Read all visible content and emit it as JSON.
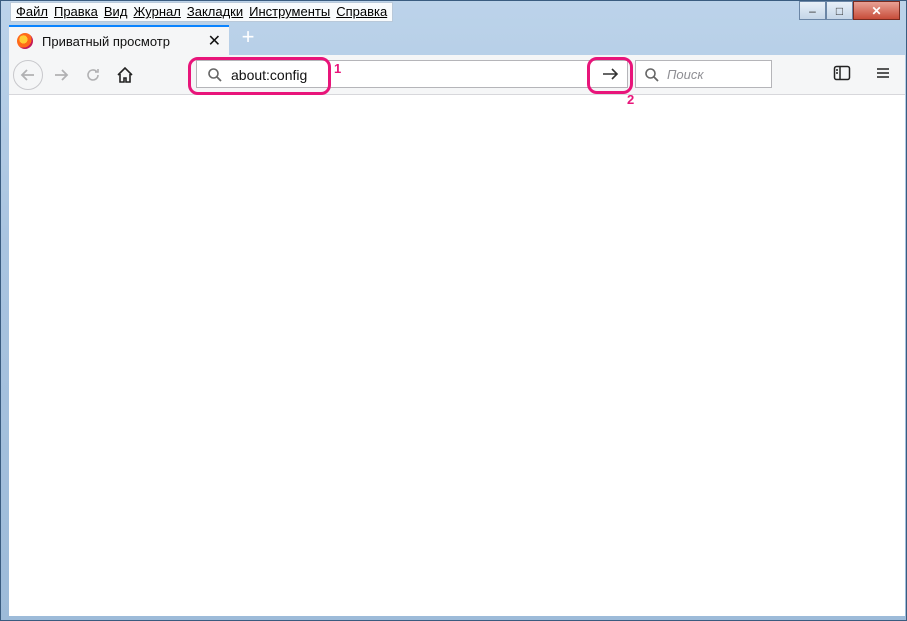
{
  "menu": [
    "Файл",
    "Правка",
    "Вид",
    "Журнал",
    "Закладки",
    "Инструменты",
    "Справка"
  ],
  "window_controls": {
    "minimize": "–",
    "maximize": "□",
    "close": "✕"
  },
  "tab": {
    "title": "Приватный просмотр",
    "close": "✕"
  },
  "new_tab": "+",
  "url": {
    "value": "about:config"
  },
  "search": {
    "placeholder": "Поиск"
  },
  "annotations": {
    "one": "1",
    "two": "2"
  },
  "colors": {
    "highlight": "#e8157a",
    "accent": "#0a84ff"
  },
  "icons": [
    "back-icon",
    "forward-icon",
    "reload-icon",
    "home-icon",
    "search-icon",
    "go-arrow-icon",
    "sidebar-icon",
    "hamburger-menu-icon",
    "firefox-icon"
  ]
}
